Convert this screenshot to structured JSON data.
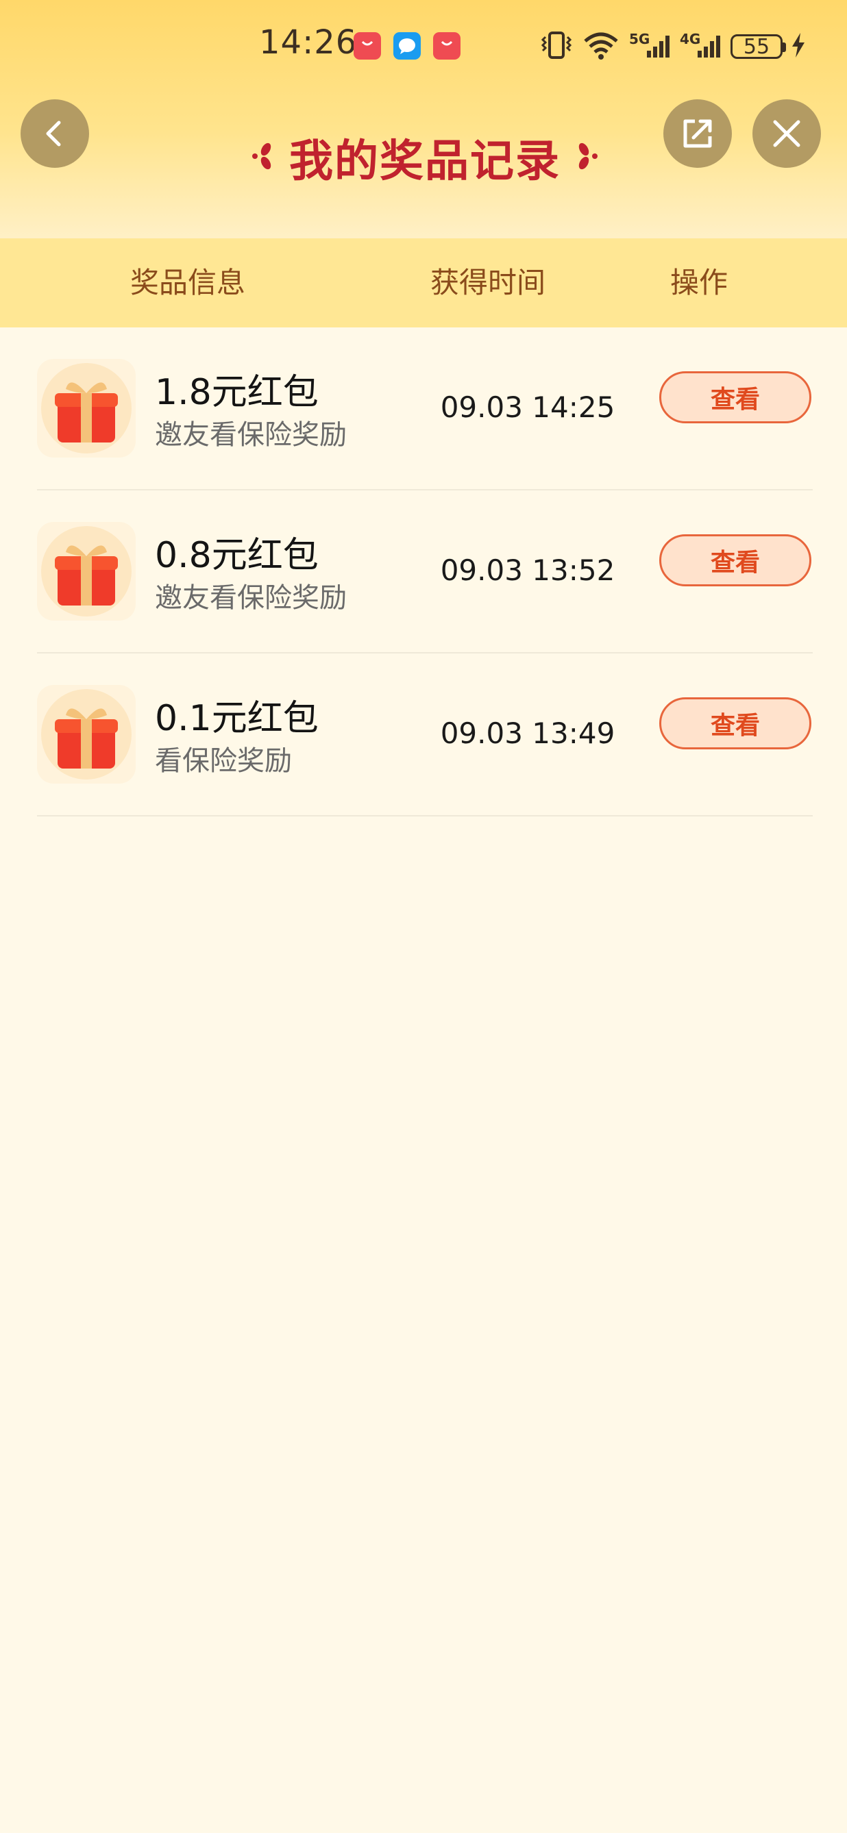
{
  "status_bar": {
    "time": "14:26",
    "battery": "55",
    "network_1": "5G",
    "network_2": "4G"
  },
  "header": {
    "title": "我的奖品记录",
    "back_icon": "chevron-left-icon",
    "share_icon": "share-external-icon",
    "close_icon": "close-icon"
  },
  "table": {
    "columns": [
      "奖品信息",
      "获得时间",
      "操作"
    ],
    "rows": [
      {
        "title": "1.8元红包",
        "subtitle": "邀友看保险奖励",
        "time": "09.03 14:25",
        "action": "查看"
      },
      {
        "title": "0.8元红包",
        "subtitle": "邀友看保险奖励",
        "time": "09.03 13:52",
        "action": "查看"
      },
      {
        "title": "0.1元红包",
        "subtitle": "看保险奖励",
        "time": "09.03 13:49",
        "action": "查看"
      }
    ]
  },
  "colors": {
    "title_red": "#c0222e",
    "header_band": "#ffe794",
    "page_bg": "#fff9e8",
    "button_border": "#e8663c"
  }
}
